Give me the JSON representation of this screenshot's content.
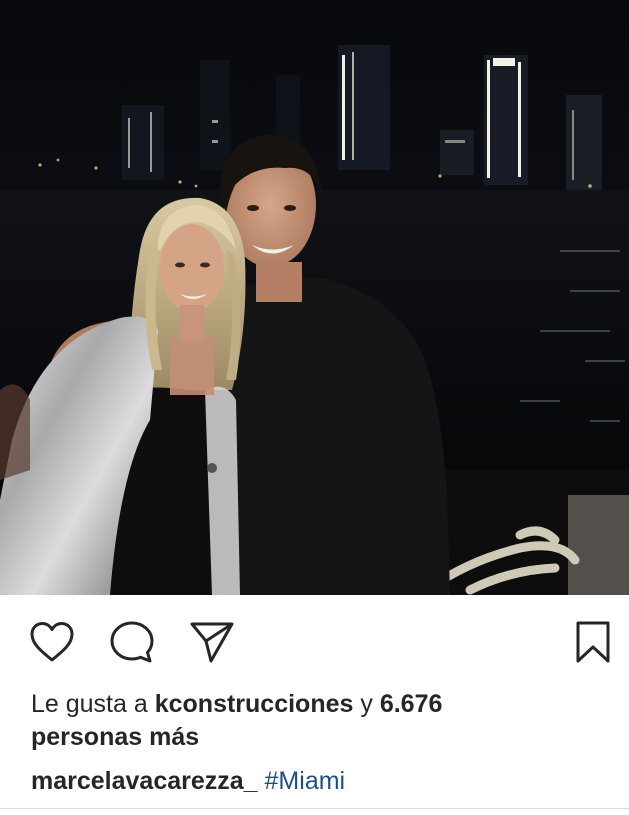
{
  "post": {
    "photo_alt": "",
    "likes": {
      "prefix": "Le gusta a",
      "user": "kconstrucciones",
      "connector": "y",
      "count": "6.676",
      "suffix": "personas más"
    },
    "caption": {
      "username": "marcelavacarezza_",
      "hashtag": "#Miami"
    }
  },
  "icons": {
    "like": "heart-icon",
    "comment": "comment-bubble-icon",
    "share": "paper-plane-icon",
    "save": "bookmark-icon"
  },
  "colors": {
    "text": "#262626",
    "hashtag": "#1f4e86",
    "divider": "#dbdbdb"
  }
}
